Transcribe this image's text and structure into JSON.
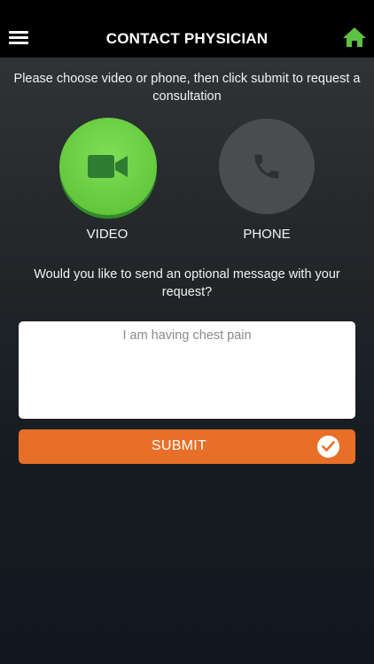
{
  "header": {
    "title": "CONTACT PHYSICIAN",
    "menu_icon": "hamburger-menu-icon",
    "home_icon": "home-icon"
  },
  "instruction": "Please choose video or phone, then click submit to request a consultation",
  "options": {
    "video": {
      "label": "VIDEO",
      "icon": "video-camera-icon",
      "selected": true,
      "color": "#67cc40"
    },
    "phone": {
      "label": "PHONE",
      "icon": "phone-handset-icon",
      "selected": false,
      "color": "#4a4c4f"
    }
  },
  "question": "Would you like to send an optional message with your request?",
  "message": {
    "value": "",
    "placeholder": "I am having chest pain"
  },
  "submit": {
    "label": "SUBMIT",
    "icon": "checkmark-circle-icon",
    "color": "#e76f28"
  },
  "colors": {
    "accent_green": "#5cc243",
    "header_bg": "#000000"
  }
}
